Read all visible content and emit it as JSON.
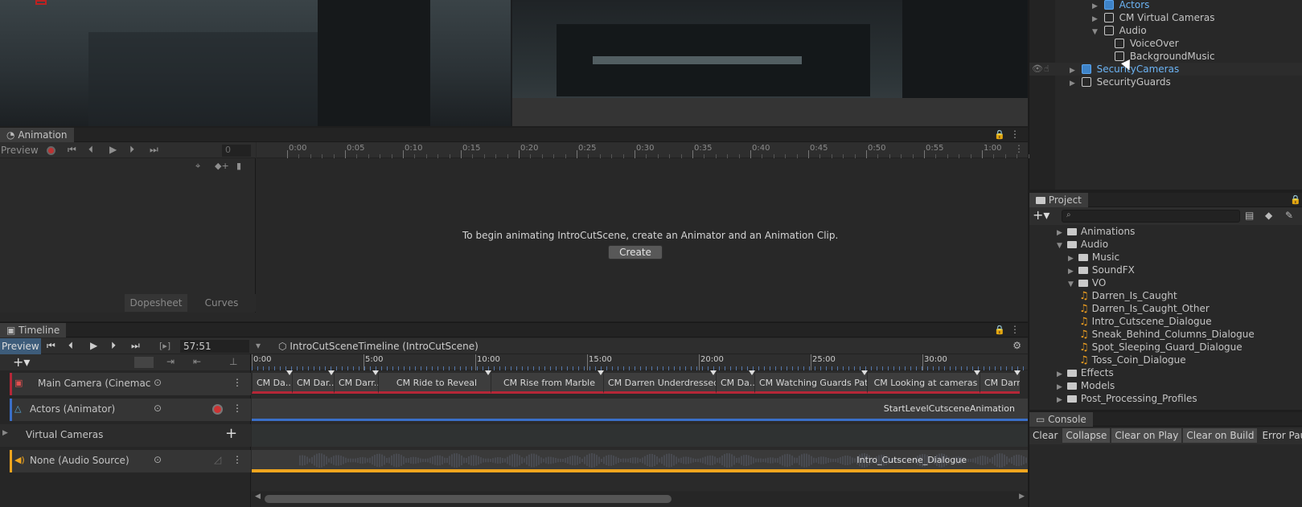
{
  "hierarchy": {
    "items": [
      {
        "label": "Actors",
        "selected": false
      },
      {
        "label": "CM Virtual Cameras"
      },
      {
        "label": "Audio"
      },
      {
        "label": "VoiceOver"
      },
      {
        "label": "BackgroundMusic"
      },
      {
        "label": "SecurityCameras"
      },
      {
        "label": "SecurityGuards"
      }
    ]
  },
  "animation": {
    "tab": "Animation",
    "preview": "Preview",
    "frame": "0",
    "ruler": [
      "0:00",
      "0:05",
      "0:10",
      "0:15",
      "0:20",
      "0:25",
      "0:30",
      "0:35",
      "0:40",
      "0:45",
      "0:50",
      "0:55",
      "1:00"
    ],
    "message": "To begin animating IntroCutScene, create an Animator and an Animation Clip.",
    "create_label": "Create",
    "dopesheet": "Dopesheet",
    "curves": "Curves"
  },
  "timeline": {
    "tab": "Timeline",
    "preview": "Preview",
    "time": "57:51",
    "asset": "IntroCutSceneTimeline (IntroCutScene)",
    "ruler": [
      "0:00",
      "5:00",
      "10:00",
      "15:00",
      "20:00",
      "25:00",
      "30:00"
    ],
    "tracks": [
      {
        "label": "Main Camera (Cinemac"
      },
      {
        "label": "Actors (Animator)"
      },
      {
        "label": "Virtual Cameras"
      },
      {
        "label": "None (Audio Source)"
      }
    ],
    "camera_clips": [
      "CM Da...",
      "CM Dar...",
      "CM Darr...",
      "CM Ride to Reveal",
      "CM Rise from Marble",
      "CM Darren Underdressed",
      "CM Da...",
      "CM Watching Guards Pat...",
      "CM Looking at cameras",
      "CM Darr"
    ],
    "animation_clip": "StartLevelCutsceneAnimation",
    "audio_clip": "Intro_Cutscene_Dialogue",
    "colors": {
      "camera": "#b52737",
      "animation": "#3a6fc8",
      "audio": "#f0a51e"
    }
  },
  "project": {
    "tab": "Project",
    "search_placeholder": "",
    "items": [
      {
        "label": "Animations",
        "type": "folder"
      },
      {
        "label": "Audio",
        "type": "folder"
      },
      {
        "label": "Music",
        "type": "folder"
      },
      {
        "label": "SoundFX",
        "type": "folder"
      },
      {
        "label": "VO",
        "type": "folder"
      },
      {
        "label": "Darren_Is_Caught",
        "type": "audio"
      },
      {
        "label": "Darren_Is_Caught_Other",
        "type": "audio"
      },
      {
        "label": "Intro_Cutscene_Dialogue",
        "type": "audio"
      },
      {
        "label": "Sneak_Behind_Columns_Dialogue",
        "type": "audio"
      },
      {
        "label": "Spot_Sleeping_Guard_Dialogue",
        "type": "audio"
      },
      {
        "label": "Toss_Coin_Dialogue",
        "type": "audio"
      },
      {
        "label": "Effects",
        "type": "folder"
      },
      {
        "label": "Models",
        "type": "folder"
      },
      {
        "label": "Post_Processing_Profiles",
        "type": "folder"
      }
    ]
  },
  "console": {
    "tab": "Console",
    "buttons": [
      "Clear",
      "Collapse",
      "Clear on Play",
      "Clear on Build",
      "Error Pause"
    ]
  }
}
